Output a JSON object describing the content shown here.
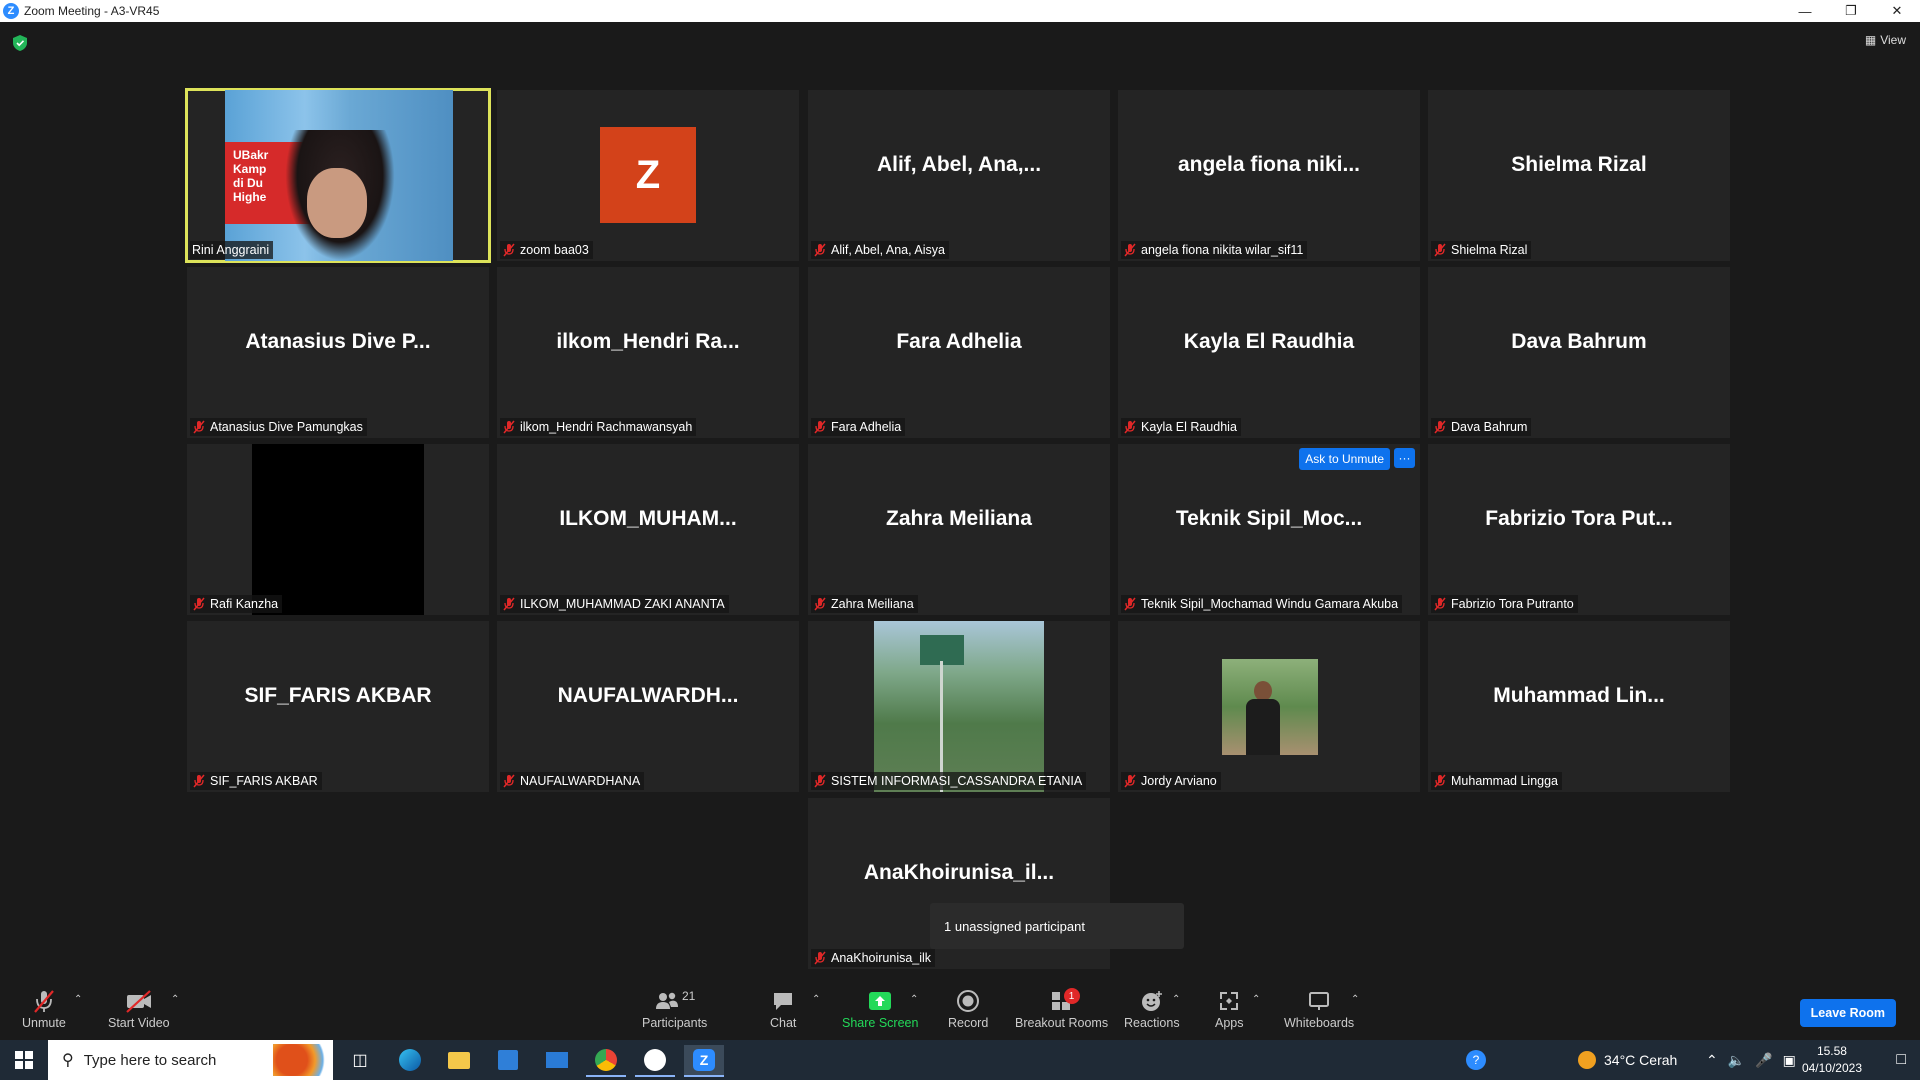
{
  "window": {
    "title": "Zoom Meeting - A3-VR45",
    "logo_letter": "Z"
  },
  "view_label": "View",
  "tiles": [
    {
      "display": "",
      "label": "Rini Anggraini",
      "muted": false
    },
    {
      "display": "Z",
      "label": "zoom baa03",
      "muted": true
    },
    {
      "display": "Alif, Abel, Ana,...",
      "label": "Alif, Abel, Ana, Aisya",
      "muted": true
    },
    {
      "display": "angela fiona niki...",
      "label": "angela fiona nikita wilar_sif11",
      "muted": true
    },
    {
      "display": "Shielma Rizal",
      "label": "Shielma Rizal",
      "muted": true
    },
    {
      "display": "Atanasius Dive P...",
      "label": "Atanasius Dive Pamungkas",
      "muted": true
    },
    {
      "display": "ilkom_Hendri Ra...",
      "label": "ilkom_Hendri Rachmawansyah",
      "muted": true
    },
    {
      "display": "Fara Adhelia",
      "label": "Fara Adhelia",
      "muted": true
    },
    {
      "display": "Kayla El Raudhia",
      "label": "Kayla El Raudhia",
      "muted": true
    },
    {
      "display": "Dava Bahrum",
      "label": "Dava Bahrum",
      "muted": true
    },
    {
      "display": "",
      "label": "Rafi Kanzha",
      "muted": true
    },
    {
      "display": "ILKOM_MUHAM...",
      "label": "ILKOM_MUHAMMAD ZAKI ANANTA",
      "muted": true
    },
    {
      "display": "Zahra Meiliana",
      "label": "Zahra Meiliana",
      "muted": true
    },
    {
      "display": "Teknik Sipil_Moc...",
      "label": "Teknik Sipil_Mochamad Windu Gamara Akuba",
      "muted": true
    },
    {
      "display": "Fabrizio Tora Put...",
      "label": "Fabrizio Tora Putranto",
      "muted": true
    },
    {
      "display": "SIF_FARIS AKBAR",
      "label": "SIF_FARIS AKBAR",
      "muted": true
    },
    {
      "display": "NAUFALWARDH...",
      "label": "NAUFALWARDHANA",
      "muted": true
    },
    {
      "display": "",
      "label": "SISTEM INFORMASI_CASSANDRA ETANIA",
      "muted": true
    },
    {
      "display": "",
      "label": "Jordy Arviano",
      "muted": true
    },
    {
      "display": "Muhammad Lin...",
      "label": "Muhammad Lingga",
      "muted": true
    },
    {
      "display": "AnaKhoirunisa_il...",
      "label": "AnaKhoirunisa_ilk",
      "muted": true
    }
  ],
  "video_sign_text": [
    "UBakr",
    "Kamp",
    "di Du",
    "Highe"
  ],
  "ask_to_unmute": "Ask to Unmute",
  "more_label": "···",
  "tooltip": "1 unassigned participant",
  "toolbar": {
    "unmute": "Unmute",
    "start_video": "Start Video",
    "participants": "Participants",
    "participant_count": "21",
    "chat": "Chat",
    "share_screen": "Share Screen",
    "record": "Record",
    "breakout_rooms": "Breakout Rooms",
    "breakout_badge": "1",
    "reactions": "Reactions",
    "apps": "Apps",
    "whiteboards": "Whiteboards",
    "leave_room": "Leave Room"
  },
  "taskbar": {
    "search_placeholder": "Type here to search",
    "weather": "34°C  Cerah",
    "time": "15.58",
    "date": "04/10/2023"
  },
  "colors": {
    "accent": "#0e72ed",
    "active_speaker_border": "#dde35a",
    "avatar_bg": "#d3421a",
    "share_green": "#23d959",
    "muted_red": "#e02828"
  }
}
